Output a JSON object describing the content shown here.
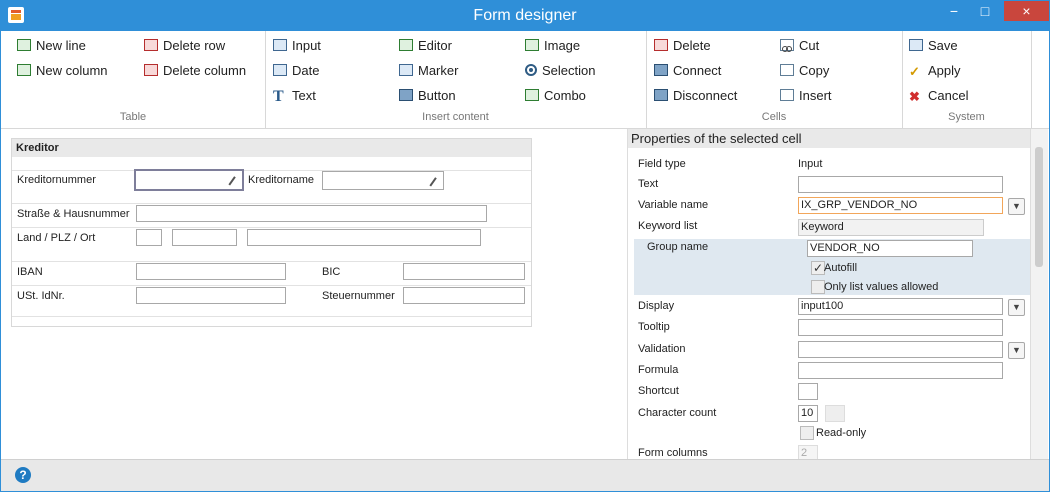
{
  "window": {
    "title": "Form designer",
    "accent": "#2f8fd8"
  },
  "ribbon": {
    "table": {
      "label": "Table",
      "buttons": [
        {
          "label": "New line",
          "icon": "new-line-icon"
        },
        {
          "label": "New column",
          "icon": "new-column-icon"
        },
        {
          "label": "Delete row",
          "icon": "delete-row-icon"
        },
        {
          "label": "Delete column",
          "icon": "delete-column-icon"
        }
      ]
    },
    "insert": {
      "label": "Insert content",
      "buttons": [
        {
          "label": "Input",
          "icon": "input-icon"
        },
        {
          "label": "Date",
          "icon": "date-icon"
        },
        {
          "label": "Text",
          "icon": "text-icon"
        },
        {
          "label": "Editor",
          "icon": "editor-icon"
        },
        {
          "label": "Marker",
          "icon": "marker-icon"
        },
        {
          "label": "Button",
          "icon": "button-icon"
        },
        {
          "label": "Image",
          "icon": "image-icon"
        },
        {
          "label": "Selection",
          "icon": "selection-icon"
        },
        {
          "label": "Combo",
          "icon": "combo-icon"
        }
      ]
    },
    "cells": {
      "label": "Cells",
      "buttons": [
        {
          "label": "Delete",
          "icon": "delete-cell-icon"
        },
        {
          "label": "Connect",
          "icon": "connect-icon"
        },
        {
          "label": "Disconnect",
          "icon": "disconnect-icon"
        },
        {
          "label": "Cut",
          "icon": "cut-icon"
        },
        {
          "label": "Copy",
          "icon": "copy-icon"
        },
        {
          "label": "Insert",
          "icon": "insert-icon"
        }
      ]
    },
    "system": {
      "label": "System",
      "buttons": [
        {
          "label": "Save",
          "icon": "save-icon"
        },
        {
          "label": "Apply",
          "icon": "apply-icon"
        },
        {
          "label": "Cancel",
          "icon": "cancel-icon"
        }
      ]
    }
  },
  "form": {
    "section_title": "Kreditor",
    "fields": {
      "kreditornummer": "Kreditornummer",
      "kreditorname": "Kreditorname",
      "strasse": "Straße & Hausnummer",
      "land": "Land / PLZ / Ort",
      "iban": "IBAN",
      "bic": "BIC",
      "ust": "USt. IdNr.",
      "steuernummer": "Steuernummer"
    }
  },
  "properties": {
    "title": "Properties of the selected cell",
    "field_type_label": "Field type",
    "field_type_value": "Input",
    "text_label": "Text",
    "text_value": "",
    "variable_name_label": "Variable name",
    "variable_name_value": "IX_GRP_VENDOR_NO",
    "keyword_list_label": "Keyword list",
    "keyword_list_value": "Keyword",
    "group_name_label": "Group name",
    "group_name_value": "VENDOR_NO",
    "autofill_label": "Autofill",
    "only_list_label": "Only list values allowed",
    "display_label": "Display",
    "display_value": "input100",
    "tooltip_label": "Tooltip",
    "validation_label": "Validation",
    "formula_label": "Formula",
    "shortcut_label": "Shortcut",
    "character_count_label": "Character count",
    "character_count_value": "10",
    "readonly_label": "Read-only",
    "form_columns_label": "Form columns",
    "form_columns_value": "2"
  },
  "status": {
    "help_symbol": "?"
  },
  "colors": {
    "titlebar": "#2f8fd8",
    "selected": "#f2a65a",
    "panel": "#dfe8f0"
  }
}
